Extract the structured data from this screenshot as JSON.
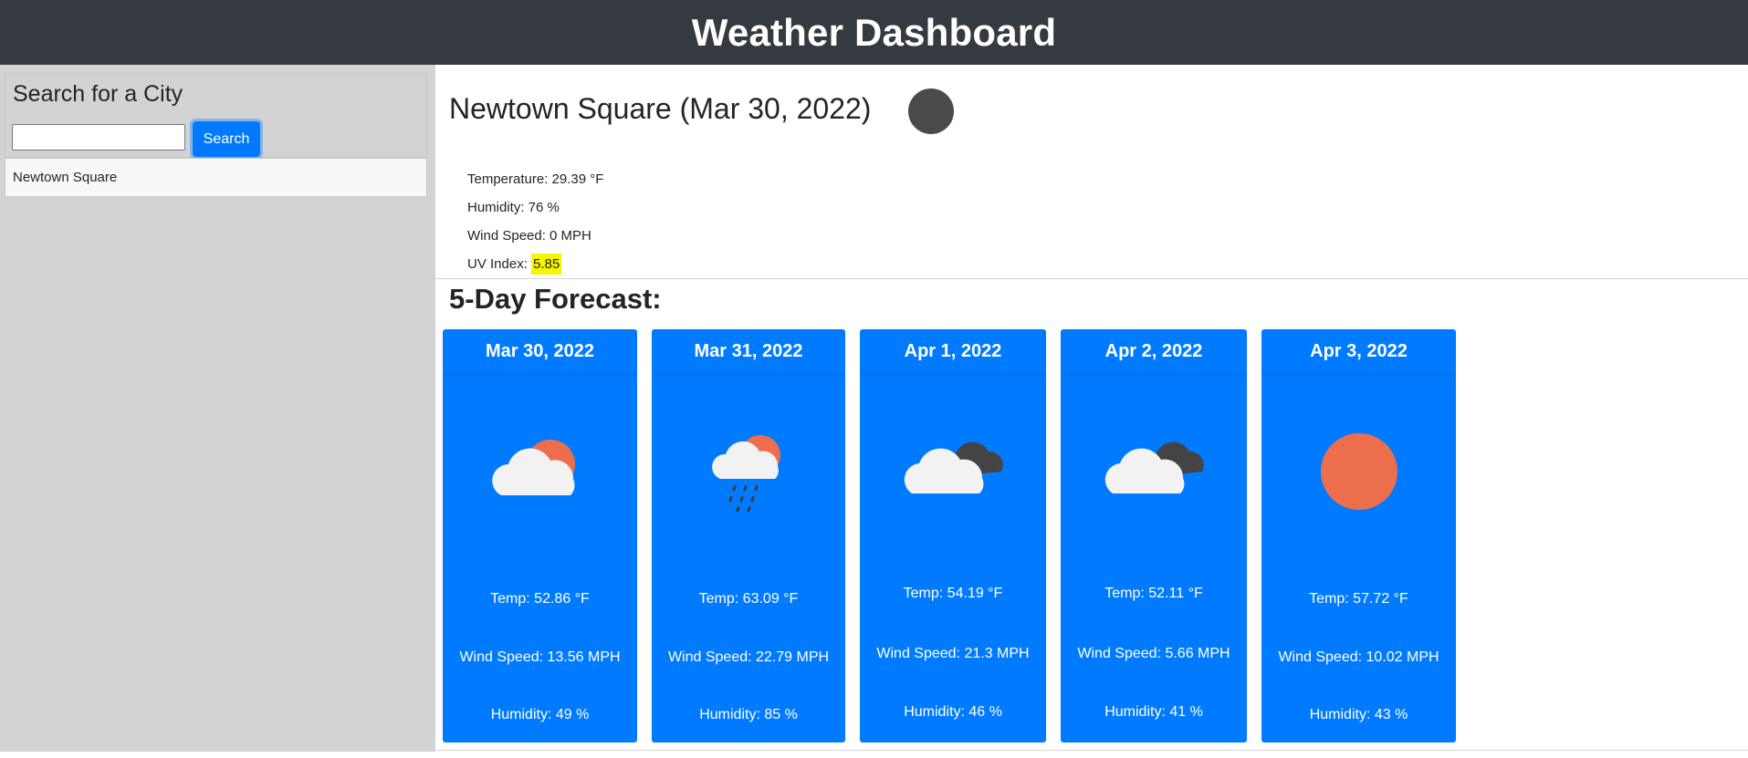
{
  "header": {
    "title": "Weather Dashboard"
  },
  "sidebar": {
    "search_heading": "Search for a City",
    "search_value": "",
    "search_placeholder": "",
    "search_button": "Search",
    "history": [
      "Newtown Square"
    ]
  },
  "current": {
    "title": "Newtown Square (Mar 30, 2022)",
    "icon": "weather-icon-placeholder",
    "temperature_label": "Temperature: 29.39 °F",
    "humidity_label": "Humidity: 76 %",
    "wind_label": "Wind Speed: 0 MPH",
    "uv_label": "UV Index: ",
    "uv_value": "5.85",
    "uv_color": "#f5f500"
  },
  "forecast": {
    "title": "5-Day Forecast:",
    "accent": "#007bff",
    "days": [
      {
        "date": "Mar 30, 2022",
        "icon": "partly-cloudy-sun-icon",
        "temp": "Temp: 52.86 °F",
        "wind": "Wind Speed: 13.56 MPH",
        "humidity": "Humidity: 49 %"
      },
      {
        "date": "Mar 31, 2022",
        "icon": "rain-cloud-sun-icon",
        "temp": "Temp: 63.09 °F",
        "wind": "Wind Speed: 22.79 MPH",
        "humidity": "Humidity: 85 %"
      },
      {
        "date": "Apr 1, 2022",
        "icon": "broken-clouds-icon",
        "temp": "Temp: 54.19 °F",
        "wind": "Wind Speed: 21.3 MPH",
        "humidity": "Humidity: 46 %"
      },
      {
        "date": "Apr 2, 2022",
        "icon": "broken-clouds-icon",
        "temp": "Temp: 52.11 °F",
        "wind": "Wind Speed: 5.66 MPH",
        "humidity": "Humidity: 41 %"
      },
      {
        "date": "Apr 3, 2022",
        "icon": "sun-icon",
        "temp": "Temp: 57.72 °F",
        "wind": "Wind Speed: 10.02 MPH",
        "humidity": "Humidity: 43 %"
      }
    ]
  }
}
